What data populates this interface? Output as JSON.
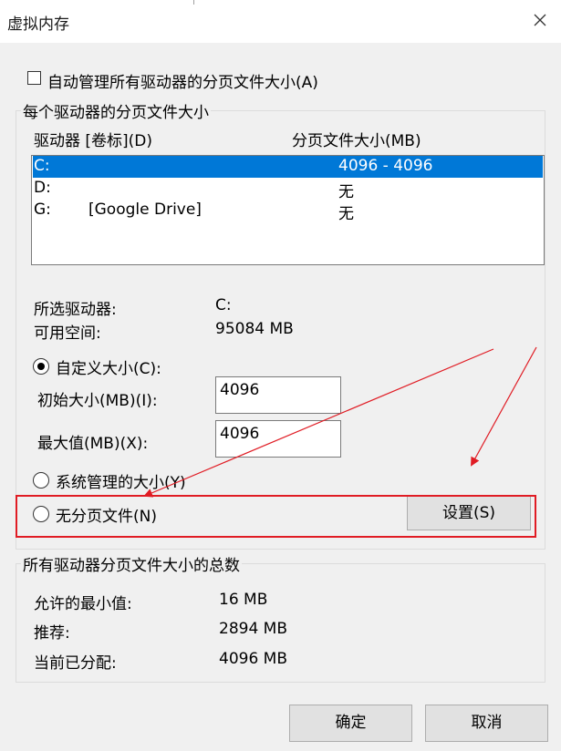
{
  "window": {
    "title": "虚拟内存"
  },
  "auto_manage": {
    "label": "自动管理所有驱动器的分页文件大小(A)",
    "checked": false
  },
  "per_drive": {
    "legend": "每个驱动器的分页文件大小",
    "col_drive": "驱动器 [卷标](D)",
    "col_size": "分页文件大小(MB)",
    "rows": [
      {
        "drive": "C:",
        "label": "",
        "size": "4096 - 4096",
        "selected": true
      },
      {
        "drive": "D:",
        "label": "",
        "size": "无",
        "selected": false
      },
      {
        "drive": "G:",
        "label": "[Google Drive]",
        "size": "无",
        "selected": false
      }
    ],
    "selected_drive_label": "所选驱动器:",
    "selected_drive_value": "C:",
    "free_space_label": "可用空间:",
    "free_space_value": "95084 MB",
    "custom_size": {
      "label": "自定义大小(C):",
      "checked": true
    },
    "initial_label": "初始大小(MB)(I):",
    "initial_value": "4096",
    "max_label": "最大值(MB)(X):",
    "max_value": "4096",
    "system_managed": {
      "label": "系统管理的大小(Y)",
      "checked": false
    },
    "no_paging": {
      "label": "无分页文件(N)",
      "checked": false
    },
    "set_button": "设置(S)"
  },
  "totals": {
    "legend": "所有驱动器分页文件大小的总数",
    "min_label": "允许的最小值:",
    "min_value": "16 MB",
    "recommended_label": "推荐:",
    "recommended_value": "2894 MB",
    "current_label": "当前已分配:",
    "current_value": "4096 MB"
  },
  "buttons": {
    "ok": "确定",
    "cancel": "取消"
  },
  "annotation": {
    "color": "#e01c24"
  }
}
